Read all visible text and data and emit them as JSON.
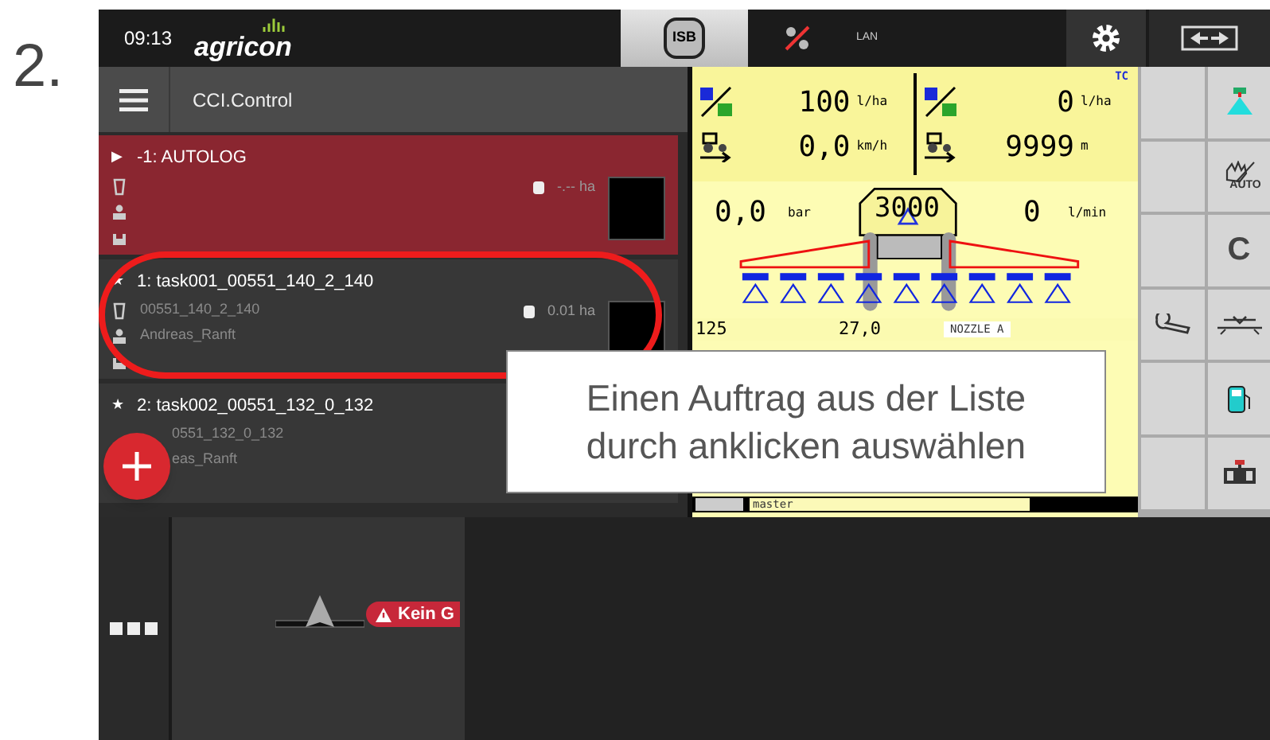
{
  "step_number": "2.",
  "status_bar": {
    "time": "09:13",
    "logo": "agricon",
    "isb": "ISB",
    "network": "LAN"
  },
  "app": {
    "title": "CCI.Control"
  },
  "tasks": [
    {
      "marker": "▶",
      "title": "-1: AUTOLOG",
      "area": "-.-- ha",
      "active": true
    },
    {
      "marker": "★",
      "title": "1: task001_00551_140_2_140",
      "field": "00551_140_2_140",
      "customer": "Andreas_Ranft",
      "area": "0.01 ha",
      "active": false
    },
    {
      "marker": "★",
      "title": "2: task002_00551_132_0_132",
      "field": "0551_132_0_132",
      "customer": "eas_Ranft",
      "active": false
    }
  ],
  "vt": {
    "rate_set": "100",
    "rate_set_unit": "l/ha",
    "speed": "0,0",
    "speed_unit": "km/h",
    "rate_actual": "0",
    "rate_actual_unit": "l/ha",
    "tc": "TC",
    "distance": "9999",
    "distance_unit": "m",
    "pressure": "0,0",
    "pressure_unit": "bar",
    "tank": "3000",
    "flow": "0",
    "flow_unit": "l/min",
    "row_value_1": "125",
    "row_value_2": "27,0",
    "nozzle": "NOZZLE A",
    "profile": "master"
  },
  "softkeys_left": [
    {
      "kind": "empty"
    },
    {
      "kind": "empty"
    },
    {
      "kind": "empty"
    },
    {
      "kind": "wrench"
    },
    {
      "kind": "empty"
    },
    {
      "kind": "empty"
    }
  ],
  "softkeys_right": [
    {
      "kind": "sprayer"
    },
    {
      "kind": "hand",
      "label": "AUTO"
    },
    {
      "kind": "text",
      "label": "C"
    },
    {
      "kind": "boom"
    },
    {
      "kind": "fuel"
    },
    {
      "kind": "valve"
    }
  ],
  "map": {
    "warning": "Kein G"
  },
  "callout": {
    "lines": [
      "Einen Auftrag aus der Liste",
      "durch anklicken auswählen"
    ]
  }
}
